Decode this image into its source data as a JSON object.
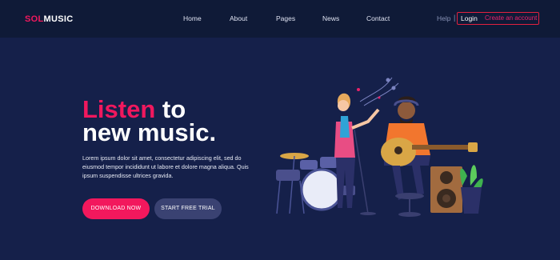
{
  "header": {
    "logo_accent": "SOL",
    "logo_rest": "MUSIC",
    "nav": [
      "Home",
      "About",
      "Pages",
      "News",
      "Contact"
    ],
    "help": "Help",
    "separator": "|",
    "login": "Login",
    "create_account": "Create an account"
  },
  "hero": {
    "headline_pink": "Listen",
    "headline_to": "to",
    "headline_line2": "new music.",
    "description": "Lorem ipsum dolor sit amet, consectetur adipiscing elit, sed do eiusmod tempor incididunt ut labore et dolore magna aliqua. Quis ipsum suspendisse ultrices gravida.",
    "primary_button": "DOWNLOAD NOW",
    "secondary_button": "START FREE TRIAL"
  },
  "colors": {
    "background": "#15204a",
    "header_bg": "#0f1a37",
    "accent": "#f0185e",
    "secondary_button": "#3a4272"
  }
}
